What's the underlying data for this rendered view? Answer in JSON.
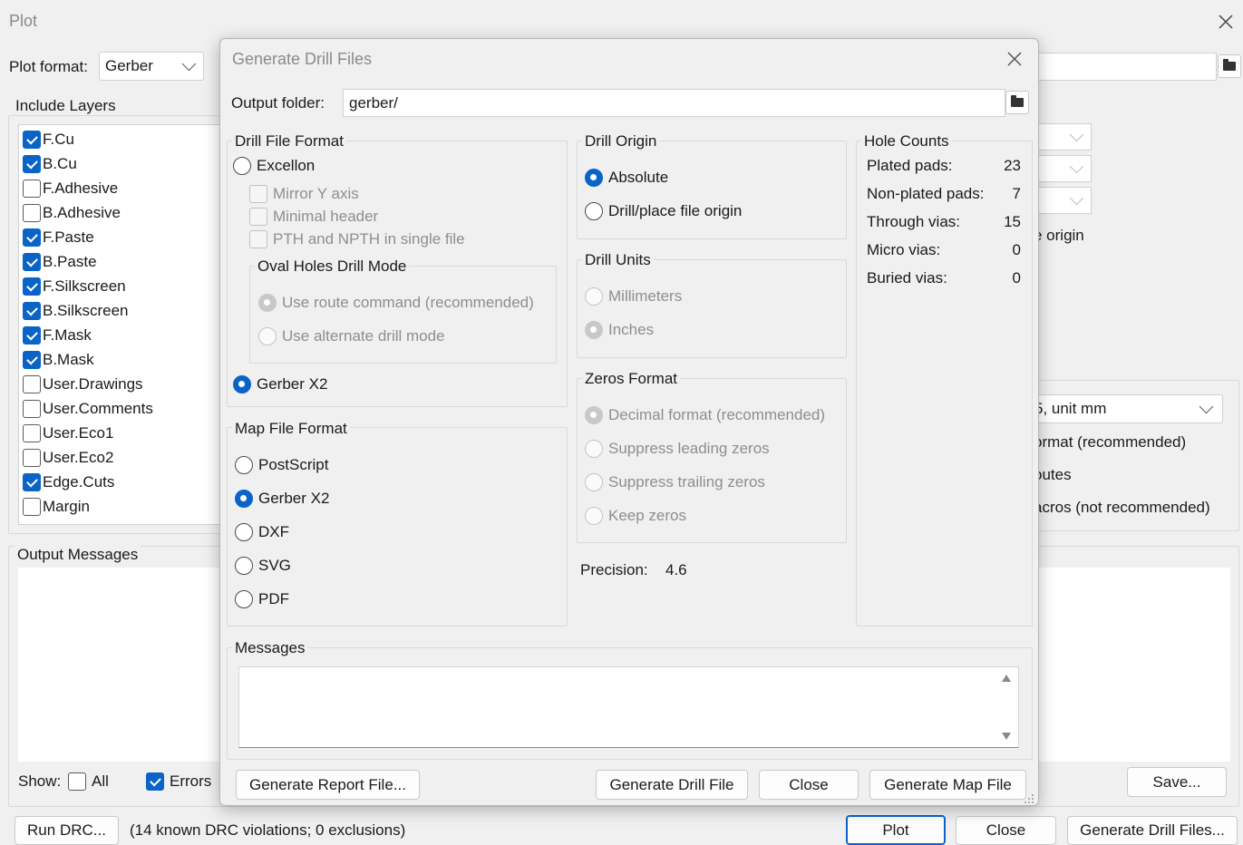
{
  "plot": {
    "title": "Plot",
    "plot_format_label": "Plot format:",
    "plot_format_value": "Gerber",
    "include_layers_title": "Include Layers",
    "layers": [
      {
        "name": "F.Cu",
        "checked": true
      },
      {
        "name": "B.Cu",
        "checked": true
      },
      {
        "name": "F.Adhesive",
        "checked": false
      },
      {
        "name": "B.Adhesive",
        "checked": false
      },
      {
        "name": "F.Paste",
        "checked": true
      },
      {
        "name": "B.Paste",
        "checked": true
      },
      {
        "name": "F.Silkscreen",
        "checked": true
      },
      {
        "name": "B.Silkscreen",
        "checked": true
      },
      {
        "name": "F.Mask",
        "checked": true
      },
      {
        "name": "B.Mask",
        "checked": true
      },
      {
        "name": "User.Drawings",
        "checked": false
      },
      {
        "name": "User.Comments",
        "checked": false
      },
      {
        "name": "User.Eco1",
        "checked": false
      },
      {
        "name": "User.Eco2",
        "checked": false
      },
      {
        "name": "Edge.Cuts",
        "checked": true
      },
      {
        "name": "Margin",
        "checked": false
      }
    ],
    "output_messages_title": "Output Messages",
    "show_label": "Show:",
    "show_all": "All",
    "show_errors": "Errors",
    "partial_origin": "e origin",
    "partial_unit": "5, unit mm",
    "partial_format": "ormat (recommended)",
    "partial_routes": "outes",
    "partial_macros": "acros (not recommended)",
    "save_button": "Save...",
    "run_drc_button": "Run DRC...",
    "drc_status": "(14 known DRC violations; 0 exclusions)",
    "plot_button": "Plot",
    "close_button": "Close",
    "generate_drill_button": "Generate Drill Files..."
  },
  "drill": {
    "title": "Generate Drill Files",
    "output_folder_label": "Output folder:",
    "output_folder_value": "gerber/",
    "drill_file_format_title": "Drill File Format",
    "excellon": "Excellon",
    "mirror_y": "Mirror Y axis",
    "minimal_header": "Minimal header",
    "pth_npth": "PTH and NPTH in single file",
    "oval_holes_title": "Oval Holes Drill Mode",
    "use_route": "Use route command (recommended)",
    "use_alternate": "Use alternate drill mode",
    "gerber_x2": "Gerber X2",
    "map_file_format_title": "Map File Format",
    "map_postscript": "PostScript",
    "map_gerber_x2": "Gerber X2",
    "map_dxf": "DXF",
    "map_svg": "SVG",
    "map_pdf": "PDF",
    "drill_origin_title": "Drill Origin",
    "absolute": "Absolute",
    "drill_place_origin": "Drill/place file origin",
    "drill_units_title": "Drill Units",
    "millimeters": "Millimeters",
    "inches": "Inches",
    "zeros_format_title": "Zeros Format",
    "decimal_format": "Decimal format (recommended)",
    "suppress_leading": "Suppress leading zeros",
    "suppress_trailing": "Suppress trailing zeros",
    "keep_zeros": "Keep zeros",
    "precision_label": "Precision:",
    "precision_value": "4.6",
    "hole_counts_title": "Hole Counts",
    "hole_counts": [
      {
        "label": "Plated pads:",
        "value": "23"
      },
      {
        "label": "Non-plated pads:",
        "value": "7"
      },
      {
        "label": "Through vias:",
        "value": "15"
      },
      {
        "label": "Micro vias:",
        "value": "0"
      },
      {
        "label": "Buried vias:",
        "value": "0"
      }
    ],
    "messages_title": "Messages",
    "generate_report_button": "Generate Report File...",
    "generate_drill_file_button": "Generate Drill File",
    "close_button": "Close",
    "generate_map_button": "Generate Map File"
  }
}
